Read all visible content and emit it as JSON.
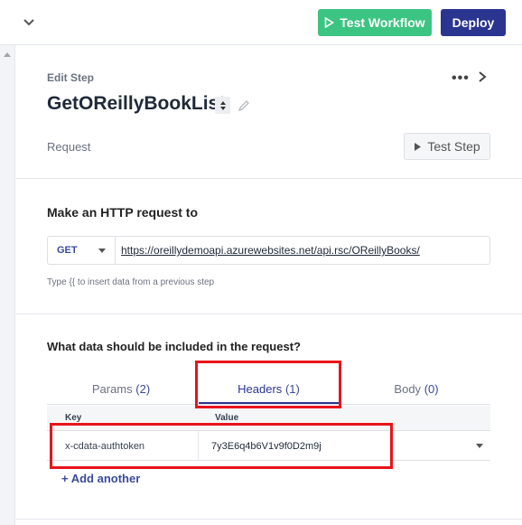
{
  "topbar": {
    "test_workflow_label": "Test Workflow",
    "deploy_label": "Deploy",
    "colors": {
      "test_workflow": "#3cc483",
      "deploy": "#2a3590"
    }
  },
  "step": {
    "edit_label": "Edit Step",
    "title": "GetOReillyBookList",
    "section_label": "Request",
    "test_step_label": "Test Step"
  },
  "http": {
    "heading": "Make an HTTP request to",
    "method": "GET",
    "url": "https://oreillydemoapi.azurewebsites.net/api.rsc/OReillyBooks/",
    "hint": "Type {{ to insert data from a previous step"
  },
  "request_data": {
    "heading": "What data should be included in the request?",
    "tabs": [
      {
        "label": "Params",
        "count": "(2)"
      },
      {
        "label": "Headers",
        "count": "(1)",
        "active": true
      },
      {
        "label": "Body",
        "count": "(0)"
      }
    ],
    "columns": {
      "key": "Key",
      "value": "Value"
    },
    "rows": [
      {
        "key": "x-cdata-authtoken",
        "value": "7y3E6q4b6V1v9f0D2m9j"
      }
    ],
    "add_label": "+ Add another"
  },
  "icons": {
    "collapse": "chevron-down-icon",
    "more": "more-dots-icon",
    "close": "chevron-right-icon",
    "edit": "pencil-icon",
    "play": "play-icon"
  },
  "annotation_color": "#e8141b"
}
